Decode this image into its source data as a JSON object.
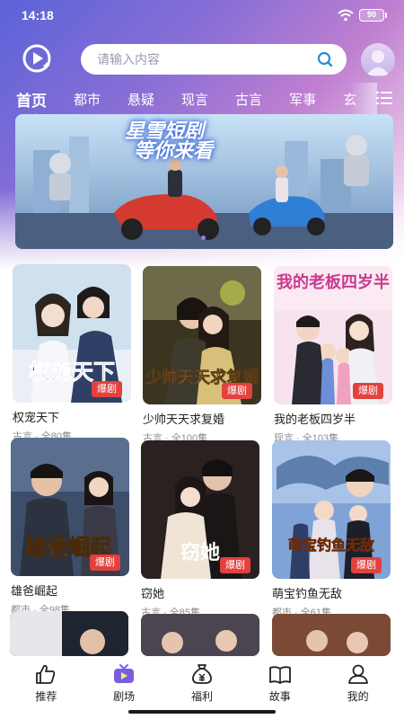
{
  "status_bar": {
    "time": "14:18",
    "battery": "90"
  },
  "search": {
    "placeholder": "请输入内容"
  },
  "tabs": [
    {
      "label": "首页",
      "active": true
    },
    {
      "label": "都市"
    },
    {
      "label": "悬疑"
    },
    {
      "label": "现言"
    },
    {
      "label": "古言"
    },
    {
      "label": "军事"
    },
    {
      "label": "玄"
    }
  ],
  "banner": {
    "line1": "星雪短剧",
    "line2": "等你来看"
  },
  "dramas": [
    {
      "title": "权宠天下",
      "category": "古言",
      "episodes": "全80集",
      "meta": "古言 · 全80集",
      "badge": "爆剧",
      "poster_text": "权宠天下"
    },
    {
      "title": "少帅天天求复婚",
      "category": "古言",
      "episodes": "全100集",
      "meta": "古言 · 全100集",
      "badge": "爆剧",
      "poster_text": "少帅天天求复婚"
    },
    {
      "title": "我的老板四岁半",
      "category": "现言",
      "episodes": "全103集",
      "meta": "现言 · 全103集",
      "badge": "爆剧",
      "poster_text": "我的老板四岁半"
    },
    {
      "title": "雄爸崛起",
      "category": "都市",
      "episodes": "全98集",
      "meta": "都市 · 全98集",
      "badge": "爆剧",
      "poster_text": "雄爸崛起"
    },
    {
      "title": "窃她",
      "category": "古言",
      "episodes": "全85集",
      "meta": "古言 · 全85集",
      "badge": "爆剧",
      "poster_text": "窃她"
    },
    {
      "title": "萌宝钓鱼无敌",
      "category": "都市",
      "episodes": "全61集",
      "meta": "都市 · 全61集",
      "badge": "爆剧",
      "poster_text": "萌宝钓鱼无敌"
    }
  ],
  "bottom_nav": [
    {
      "label": "推荐",
      "icon": "thumbs-up-icon"
    },
    {
      "label": "剧场",
      "icon": "tv-icon",
      "active": true
    },
    {
      "label": "福利",
      "icon": "money-bag-icon"
    },
    {
      "label": "故事",
      "icon": "book-icon"
    },
    {
      "label": "我的",
      "icon": "person-icon"
    }
  ],
  "colors": {
    "accent": "#7b5ce0",
    "badge": "#e2413e",
    "header_start": "#5b63d8",
    "header_end": "#e9c9ea"
  }
}
